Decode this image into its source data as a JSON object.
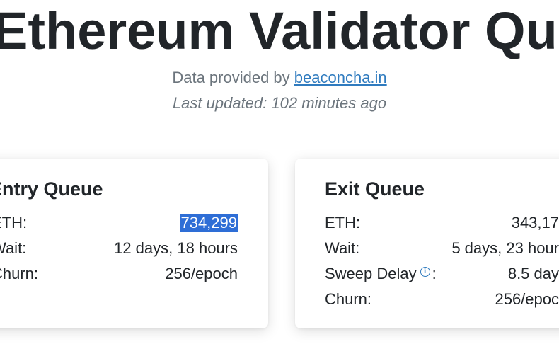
{
  "header": {
    "title": "Ethereum Validator Queue",
    "data_provided_prefix": "Data provided by",
    "data_source_link": "beaconcha.in",
    "last_updated": "Last updated: 102 minutes ago"
  },
  "entry_queue": {
    "title": "Entry Queue",
    "eth_label": "ETH:",
    "eth_value": "734,299",
    "wait_label": "Wait:",
    "wait_value": "12 days, 18 hours",
    "churn_label": "Churn:",
    "churn_value": "256/epoch"
  },
  "exit_queue": {
    "title": "Exit Queue",
    "eth_label": "ETH:",
    "eth_value": "343,17",
    "wait_label": "Wait:",
    "wait_value": "5 days, 23 hour",
    "sweep_label": "Sweep Delay",
    "sweep_suffix": ":",
    "sweep_value": "8.5 day",
    "churn_label": "Churn:",
    "churn_value": "256/epoc"
  },
  "icons": {
    "info": "info-icon"
  },
  "colors": {
    "link": "#2f7bbf",
    "selection": "#2e6ed6",
    "muted": "#6c757d",
    "text": "#212529"
  }
}
